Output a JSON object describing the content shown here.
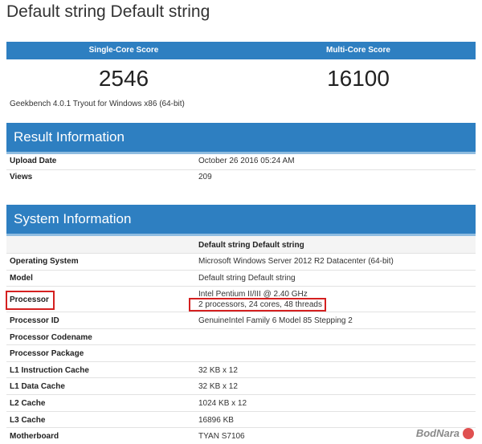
{
  "page_title": "Default string Default string",
  "scores": {
    "single_label": "Single-Core Score",
    "multi_label": "Multi-Core Score",
    "single_value": "2546",
    "multi_value": "16100",
    "version_note": "Geekbench 4.0.1 Tryout for Windows x86 (64-bit)"
  },
  "result_info": {
    "title": "Result Information",
    "rows": [
      {
        "key": "Upload Date",
        "value": "October 26 2016 05:24 AM"
      },
      {
        "key": "Views",
        "value": "209"
      }
    ]
  },
  "system_info": {
    "title": "System Information",
    "column_header": "Default string Default string",
    "rows": [
      {
        "key": "Operating System",
        "value": "Microsoft Windows Server 2012 R2 Datacenter (64-bit)"
      },
      {
        "key": "Model",
        "value": "Default string Default string"
      },
      {
        "key": "Processor",
        "value": "Intel Pentium II/III @ 2.40 GHz",
        "value2": "2 processors, 24 cores, 48 threads"
      },
      {
        "key": "Processor ID",
        "value": "GenuineIntel Family 6 Model 85 Stepping 2"
      },
      {
        "key": "Processor Codename",
        "value": ""
      },
      {
        "key": "Processor Package",
        "value": ""
      },
      {
        "key": "L1 Instruction Cache",
        "value": "32 KB x 12"
      },
      {
        "key": "L1 Data Cache",
        "value": "32 KB x 12"
      },
      {
        "key": "L2 Cache",
        "value": "1024 KB x 12"
      },
      {
        "key": "L3 Cache",
        "value": "16896 KB"
      },
      {
        "key": "Motherboard",
        "value": "TYAN S7106"
      }
    ]
  },
  "watermark": "BodNara",
  "colors": {
    "header_blue": "#2e7fc1",
    "highlight_red": "#d42020"
  }
}
